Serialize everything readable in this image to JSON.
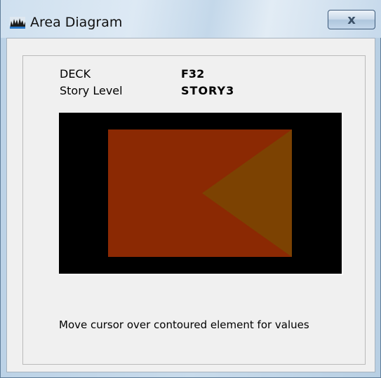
{
  "window": {
    "title": "Area Diagram",
    "app_icon": "area-diagram-icon",
    "close_icon": "close-icon",
    "close_glyph": "x"
  },
  "info": {
    "deck_label": "DECK",
    "deck_value": "F32",
    "story_label": "Story Level",
    "story_value": "STORY3"
  },
  "diagram": {
    "background_color": "#000000",
    "rect_color": "#8b2903",
    "triangle_color": "#7c4202"
  },
  "hint_text": "Move cursor over contoured element for values"
}
